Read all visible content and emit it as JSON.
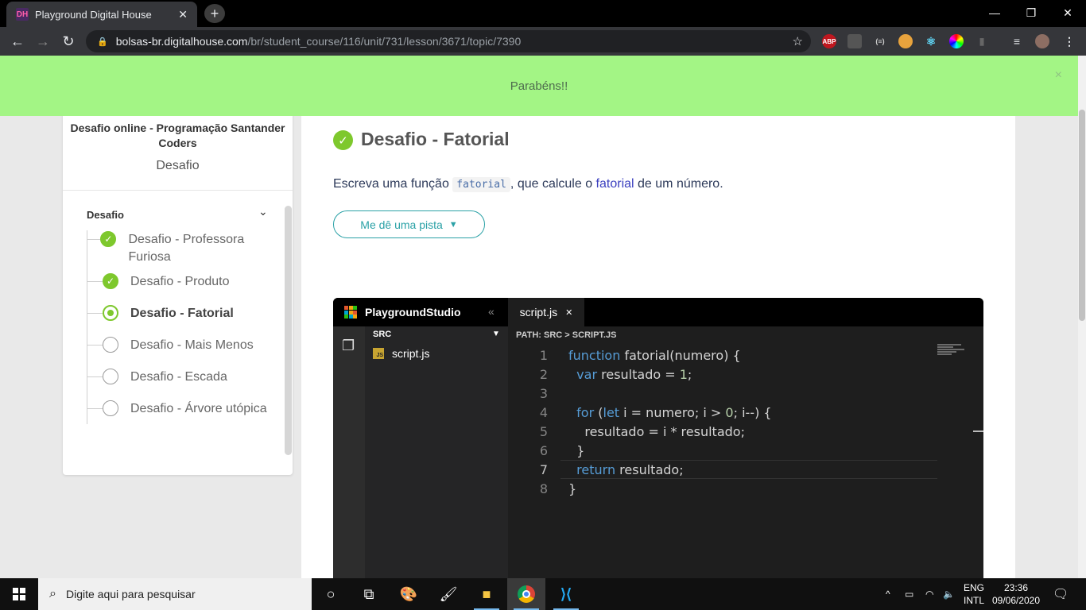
{
  "browser": {
    "tab_title": "Playground Digital House",
    "favicon_text": "DH",
    "url_host": "bolsas-br.digitalhouse.com",
    "url_path": "/br/student_course/116/unit/731/lesson/3671/topic/7390",
    "extensions": [
      "ABP"
    ]
  },
  "banner": {
    "message": "Parabéns!!",
    "close": "×"
  },
  "sidebar": {
    "course_title": "Desafio online - Programação Santander Coders",
    "subtitle": "Desafio",
    "section": "Desafio",
    "items": [
      {
        "label": "Desafio - Professora Furiosa",
        "status": "done"
      },
      {
        "label": "Desafio - Produto",
        "status": "done"
      },
      {
        "label": "Desafio - Fatorial",
        "status": "current"
      },
      {
        "label": "Desafio - Mais Menos",
        "status": "todo"
      },
      {
        "label": "Desafio - Escada",
        "status": "todo"
      },
      {
        "label": "Desafio - Árvore utópica",
        "status": "todo"
      }
    ]
  },
  "main": {
    "title": "Desafio - Fatorial",
    "desc_before": "Escreva uma função ",
    "desc_code": "fatorial",
    "desc_middle": ", que calcule o ",
    "desc_link": "fatorial",
    "desc_after": " de um número.",
    "hint_button": "Me dê uma pista"
  },
  "editor": {
    "brand": "PlaygroundStudio",
    "tab": "script.js",
    "explorer_header": "SRC",
    "file": "script.js",
    "file_badge": "JS",
    "path": "PATH: SRC > SCRIPT.JS",
    "active_line": 7,
    "lines": [
      "function fatorial(numero) {",
      "  var resultado = 1;",
      "",
      "  for (let i = numero; i > 0; i--) {",
      "    resultado = i * resultado;",
      "  }",
      "  return resultado;",
      "}"
    ]
  },
  "taskbar": {
    "search_placeholder": "Digite aqui para pesquisar",
    "lang_top": "ENG",
    "lang_bottom": "INTL",
    "time": "23:36",
    "date": "09/06/2020"
  }
}
